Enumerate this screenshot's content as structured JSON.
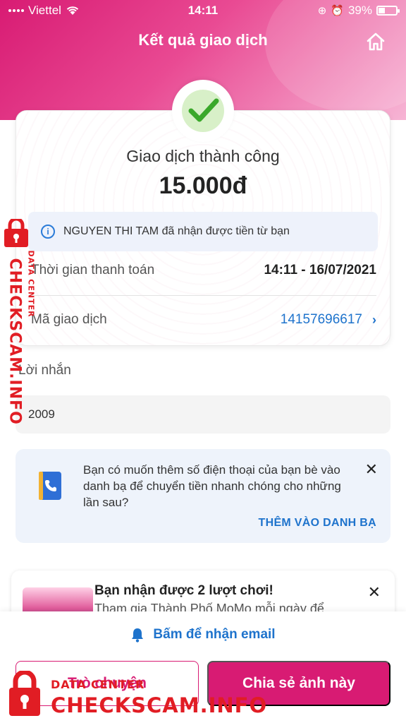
{
  "status_bar": {
    "carrier": "Viettel",
    "time": "14:11",
    "battery": "39%"
  },
  "header": {
    "title": "Kết quả giao dịch"
  },
  "transaction": {
    "status": "Giao dịch thành công",
    "amount": "15.000đ",
    "info_message": "NGUYEN THI TAM đã nhận được tiền từ bạn",
    "time_label": "Thời gian thanh toán",
    "time_value": "14:11 - 16/07/2021",
    "id_label": "Mã giao dịch",
    "id_value": "14157696617"
  },
  "message": {
    "label": "Lời nhắn",
    "value": "2009"
  },
  "contact_prompt": {
    "text": "Bạn có muốn thêm số điện thoại của bạn bè vào danh bạ để chuyển tiền nhanh chóng cho những lần sau?",
    "action": "THÊM VÀO DANH BẠ"
  },
  "game_promo": {
    "title": "Bạn nhận được 2 lượt chơi!",
    "subtitle": "Tham gia Thành Phố MoMo mỗi ngày để"
  },
  "bottom": {
    "email_link": "Bấm để nhận email",
    "chat_button": "Trò chuyện",
    "share_button": "Chia sẻ ảnh này"
  },
  "watermark": {
    "data_center": "DATA CENTER",
    "site": "CHECKSCAM.INFO"
  },
  "colors": {
    "brand": "#d81b73",
    "link": "#1e73cc",
    "watermark": "#e11d24"
  }
}
